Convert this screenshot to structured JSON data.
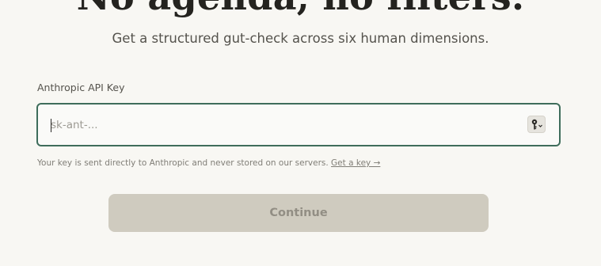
{
  "header": {
    "headline": "No agenda, no filters.",
    "subheadline": "Get a structured gut-check across six human dimensions."
  },
  "form": {
    "label": "Anthropic API Key",
    "input_value": "",
    "input_placeholder": "sk-ant-...",
    "key_icon": "key-chevron-icon",
    "helper_text": "Your key is sent directly to Anthropic and never stored on our servers. ",
    "get_key_link": "Get a key →",
    "continue_label": "Continue"
  },
  "colors": {
    "background": "#f8f7f3",
    "input_border_focus": "#3e6d5b",
    "button_disabled_bg": "#cfcbbf",
    "button_disabled_text": "#928e84"
  }
}
